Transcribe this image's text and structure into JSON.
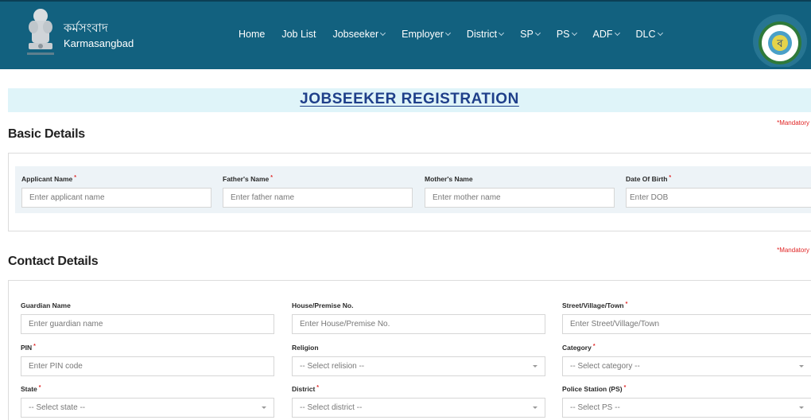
{
  "header": {
    "brand_bengali": "কর্মসংবাদ",
    "brand_english": "Karmasangbad",
    "nav": [
      {
        "label": "Home",
        "dropdown": false
      },
      {
        "label": "Job List",
        "dropdown": false
      },
      {
        "label": "Jobseeker",
        "dropdown": true
      },
      {
        "label": "Employer",
        "dropdown": true
      },
      {
        "label": "District",
        "dropdown": true
      },
      {
        "label": "SP",
        "dropdown": true
      },
      {
        "label": "PS",
        "dropdown": true
      },
      {
        "label": "ADF",
        "dropdown": true
      },
      {
        "label": "DLC",
        "dropdown": true
      }
    ],
    "colors": {
      "header_bg": "#12617f",
      "title_bg": "#dff4f9",
      "title_text": "#1f3f8a",
      "required": "#e02424"
    }
  },
  "page": {
    "title": "JOBSEEKER REGISTRATION",
    "mandatory_note": "*Mandatory"
  },
  "basic": {
    "title": "Basic Details",
    "fields": [
      {
        "label": "Applicant Name",
        "required": "*",
        "placeholder": "Enter applicant name"
      },
      {
        "label": "Father's Name",
        "required": "*",
        "placeholder": "Enter father name"
      },
      {
        "label": "Mother's Name",
        "required": "",
        "placeholder": "Enter mother name"
      },
      {
        "label": "Date Of Birth",
        "required": "*",
        "placeholder": "Enter DOB"
      }
    ]
  },
  "contact": {
    "title": "Contact Details",
    "fields": [
      {
        "label": "Guardian Name",
        "required": "",
        "placeholder": "Enter guardian name",
        "type": "input"
      },
      {
        "label": "House/Premise No.",
        "required": "",
        "placeholder": "Enter House/Premise No.",
        "type": "input"
      },
      {
        "label": "Street/Village/Town",
        "required": "*",
        "placeholder": "Enter Street/Village/Town",
        "type": "input"
      },
      {
        "label": "PIN",
        "required": "*",
        "placeholder": "Enter PIN code",
        "type": "input"
      },
      {
        "label": "Religion",
        "required": "",
        "placeholder": "-- Select relision --",
        "type": "select"
      },
      {
        "label": "Category",
        "required": "*",
        "placeholder": "-- Select category --",
        "type": "select"
      },
      {
        "label": "State",
        "required": "*",
        "placeholder": "-- Select state --",
        "type": "select"
      },
      {
        "label": "District",
        "required": "*",
        "placeholder": "-- Select district --",
        "type": "select"
      },
      {
        "label": "Police Station (PS)",
        "required": "*",
        "placeholder": "-- Select PS --",
        "type": "select"
      }
    ]
  }
}
